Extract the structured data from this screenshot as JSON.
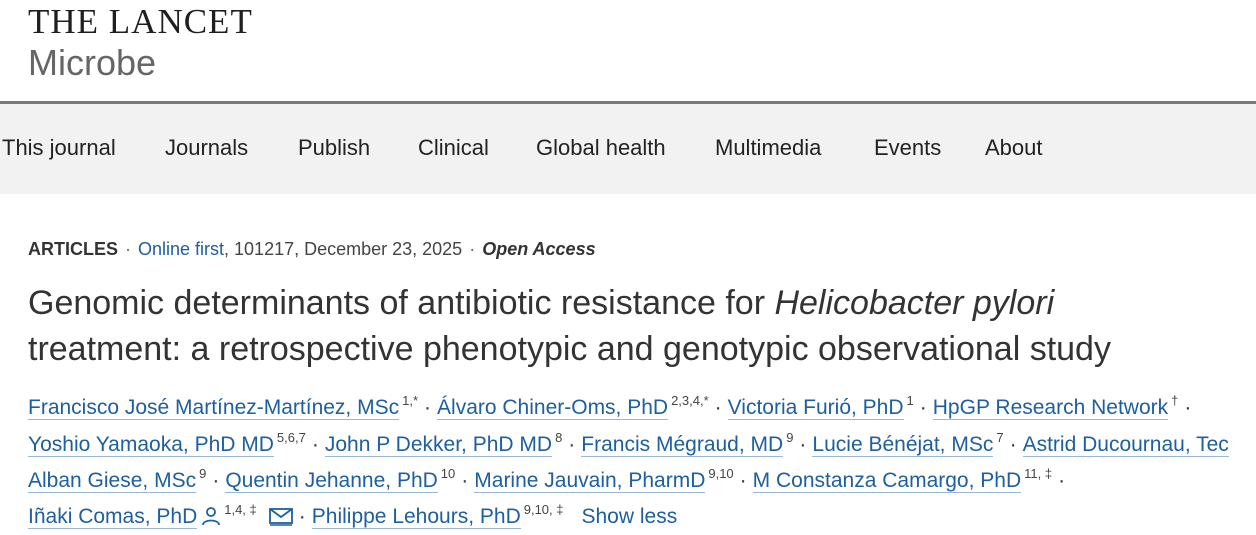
{
  "header": {
    "logo_line1": "THE LANCET",
    "logo_line2": "Microbe"
  },
  "nav": {
    "items": [
      "This journal",
      "Journals",
      "Publish",
      "Clinical",
      "Global health",
      "Multimedia",
      "Events",
      "About"
    ]
  },
  "article": {
    "type": "ARTICLES",
    "online_first": "Online first",
    "article_number": ", 101217, December 23, 2025",
    "open_access": "Open Access",
    "title_part1": "Genomic determinants of antibiotic resistance for ",
    "title_italic": "Helicobacter pylori",
    "title_part2": " treatment: a retrospective phenotypic and genotypic observational study"
  },
  "authors": [
    {
      "name": "Francisco José Martínez-Martínez, MSc",
      "aff": "1,*"
    },
    {
      "name": "Álvaro Chiner-Oms, PhD",
      "aff": "2,3,4,*"
    },
    {
      "name": "Victoria Furió, PhD",
      "aff": "1"
    },
    {
      "name": "HpGP Research Network",
      "aff": "†"
    },
    {
      "name": "Yoshio Yamaoka, PhD MD",
      "aff": "5,6,7"
    },
    {
      "name": "John P Dekker, PhD MD",
      "aff": "8"
    },
    {
      "name": "Francis Mégraud, MD",
      "aff": "9"
    },
    {
      "name": "Lucie Bénéjat, MSc",
      "aff": "7"
    },
    {
      "name": "Astrid Ducournau, Tec",
      "aff": ""
    },
    {
      "name": "Alban Giese, MSc",
      "aff": "9"
    },
    {
      "name": "Quentin Jehanne, PhD",
      "aff": "10"
    },
    {
      "name": "Marine Jauvain, PharmD",
      "aff": "9,10"
    },
    {
      "name": "M Constanza Camargo, PhD",
      "aff": "11, ‡"
    },
    {
      "name": "Iñaki Comas, PhD",
      "aff": "1,4, ‡"
    },
    {
      "name": "Philippe Lehours, PhD",
      "aff": "9,10, ‡"
    }
  ],
  "show_less": "Show less",
  "icons": {
    "author_profile": "person-icon",
    "email": "envelope-icon"
  },
  "colors": {
    "link": "#1d5fa0",
    "nav_bg": "#f2f2f2",
    "rule": "#7a7a7a"
  }
}
